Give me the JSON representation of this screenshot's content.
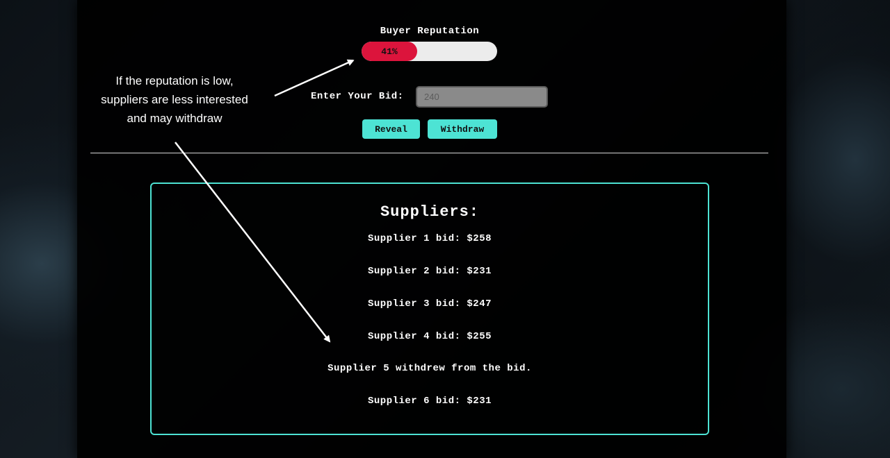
{
  "reputation": {
    "label": "Buyer Reputation",
    "percent": 41,
    "percent_text": "41%",
    "fill_color": "#dc143c",
    "track_color": "#ececec"
  },
  "bid": {
    "label": "Enter Your Bid:",
    "placeholder": "240"
  },
  "buttons": {
    "reveal": "Reveal",
    "withdraw": "Withdraw",
    "color": "#4de3d4"
  },
  "suppliers": {
    "title": "Suppliers:",
    "lines": [
      "Supplier 1 bid: $258",
      "Supplier 2 bid: $231",
      "Supplier 3 bid: $247",
      "Supplier 4 bid: $255",
      "Supplier 5 withdrew from the bid.",
      "Supplier 6 bid: $231"
    ]
  },
  "annotation": {
    "line1": "If the reputation is low,",
    "line2": "suppliers are less interested",
    "line3": "and may withdraw"
  }
}
